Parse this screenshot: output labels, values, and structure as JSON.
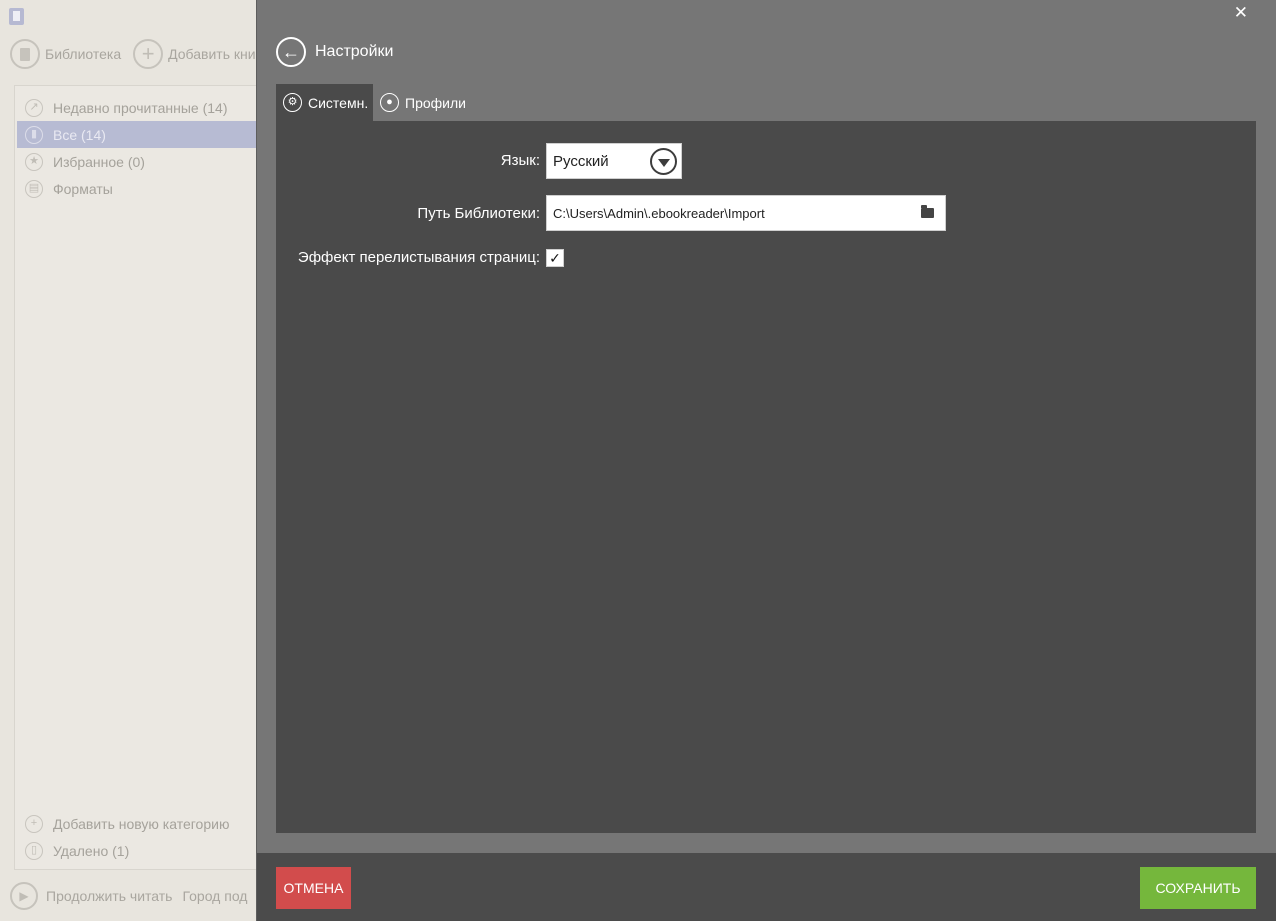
{
  "library": {
    "toolbar": {
      "library_label": "Библиотека",
      "add_label": "Добавить кни"
    },
    "categories": [
      {
        "label": "Недавно прочитанные (14)",
        "icon": "share-icon"
      },
      {
        "label": "Все (14)",
        "icon": "book-icon"
      },
      {
        "label": "Избранное (0)",
        "icon": "star-icon"
      },
      {
        "label": "Форматы",
        "icon": "file-icon"
      }
    ],
    "add_category": "Добавить новую категорию",
    "deleted": "Удалено (1)",
    "continue_label": "Продолжить читать",
    "current_book": "Город под"
  },
  "settings": {
    "title": "Настройки",
    "tabs": [
      {
        "label": "Системн."
      },
      {
        "label": "Профили"
      }
    ],
    "language": {
      "label": "Язык:",
      "value": "Русский"
    },
    "library_path": {
      "label": "Путь Библиотеки:",
      "value": "C:\\Users\\Admin\\.ebookreader\\Import"
    },
    "page_flip": {
      "label": "Эффект перелистывания страниц:",
      "checked": true
    },
    "cancel_label": "ОТМЕНА",
    "save_label": "СОХРАНИТЬ"
  },
  "colors": {
    "overlay": "#767676",
    "panel": "#4a4a4a",
    "cancel": "#d24c4c",
    "save": "#75b73c",
    "selected_category": "#b7bbd3"
  }
}
